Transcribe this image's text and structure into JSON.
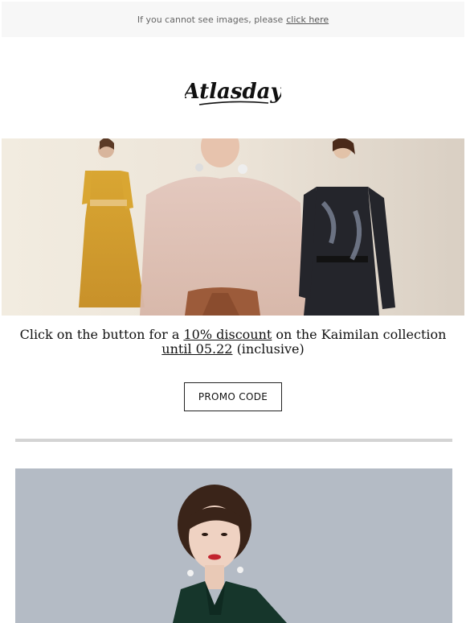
{
  "preheader": {
    "text": "If you cannot see images, please",
    "link_label": "click here"
  },
  "brand": {
    "logo_text": "Atlasday"
  },
  "hero": {
    "icon": "hero-banner-image"
  },
  "promo": {
    "line1_prefix": "Click on the button for a",
    "line1_discount": "10% discount",
    "line1_suffix": "on the Kaimilan collection",
    "line2_until": "until 05.22",
    "line2_suffix": "(inclusive)",
    "button_label": "PROMO CODE"
  },
  "colors": {
    "preheader_bg": "#f7f7f7",
    "divider": "#d4d4d4",
    "button_border": "#222222"
  }
}
